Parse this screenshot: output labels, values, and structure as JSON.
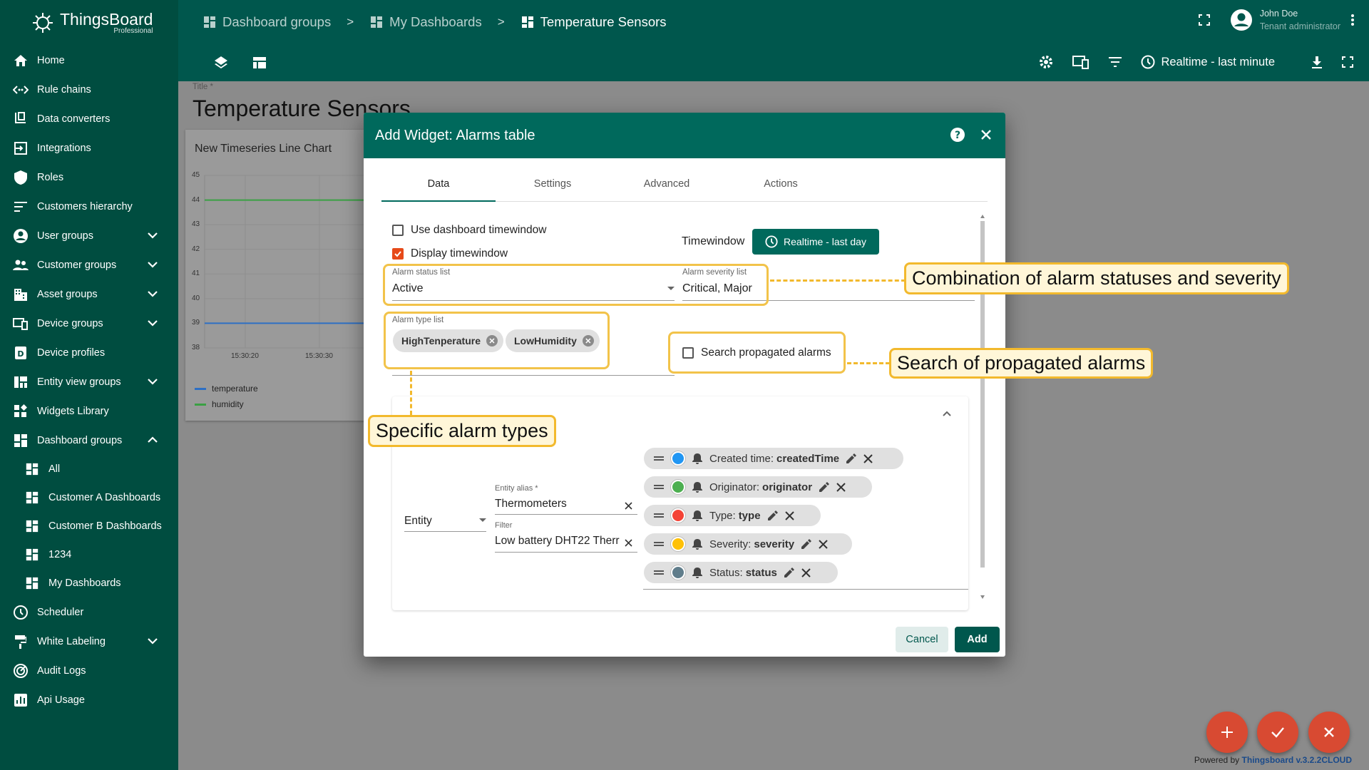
{
  "app": {
    "brand": "ThingsBoard",
    "edition": "Professional"
  },
  "sidebar": {
    "items": [
      {
        "label": "Home",
        "icon": "home-icon"
      },
      {
        "label": "Rule chains",
        "icon": "rule-chains-icon"
      },
      {
        "label": "Data converters",
        "icon": "converter-icon"
      },
      {
        "label": "Integrations",
        "icon": "integrations-icon"
      },
      {
        "label": "Roles",
        "icon": "shield-icon"
      },
      {
        "label": "Customers hierarchy",
        "icon": "hierarchy-icon"
      },
      {
        "label": "User groups",
        "icon": "account-circle-icon",
        "expandable": true
      },
      {
        "label": "Customer groups",
        "icon": "supervisor-icon",
        "expandable": true
      },
      {
        "label": "Asset groups",
        "icon": "domain-icon",
        "expandable": true
      },
      {
        "label": "Device groups",
        "icon": "devices-icon",
        "expandable": true
      },
      {
        "label": "Device profiles",
        "icon": "device-profile-icon"
      },
      {
        "label": "Entity view groups",
        "icon": "view-quilt-icon",
        "expandable": true
      },
      {
        "label": "Widgets Library",
        "icon": "widgets-icon"
      },
      {
        "label": "Dashboard groups",
        "icon": "dashboard-icon",
        "expanded": true
      },
      {
        "label": "All",
        "icon": "dashboard-icon",
        "sub": true
      },
      {
        "label": "Customer A Dashboards",
        "icon": "dashboard-icon",
        "sub": true
      },
      {
        "label": "Customer B Dashboards",
        "icon": "dashboard-icon",
        "sub": true
      },
      {
        "label": "1234",
        "icon": "dashboard-icon",
        "sub": true
      },
      {
        "label": "My Dashboards",
        "icon": "dashboard-icon",
        "sub": true
      },
      {
        "label": "Scheduler",
        "icon": "schedule-icon"
      },
      {
        "label": "White Labeling",
        "icon": "format-paint-icon",
        "expandable": true
      },
      {
        "label": "Audit Logs",
        "icon": "track-changes-icon"
      },
      {
        "label": "Api Usage",
        "icon": "insert-chart-icon"
      }
    ]
  },
  "header": {
    "breadcrumbs": [
      "Dashboard groups",
      "My Dashboards",
      "Temperature Sensors"
    ],
    "user_name": "John Doe",
    "user_role": "Tenant administrator",
    "timewindow": "Realtime - last minute"
  },
  "dashboard": {
    "title_label": "Title *",
    "title": "Temperature Sensors",
    "chart_title": "New Timeseries Line Chart"
  },
  "chart_data": {
    "type": "line",
    "title": "New Timeseries Line Chart",
    "x_ticks": [
      "15:30:20",
      "15:30:30"
    ],
    "y_ticks": [
      45,
      44,
      43,
      42,
      41,
      40,
      39,
      38
    ],
    "ylim": [
      38,
      45
    ],
    "series": [
      {
        "name": "temperature",
        "color": "#2d6fc4",
        "values": [
          39,
          39
        ]
      },
      {
        "name": "humidity",
        "color": "#3aa043",
        "values": [
          44,
          44
        ]
      }
    ]
  },
  "dialog": {
    "title": "Add Widget: Alarms table",
    "tabs": [
      "Data",
      "Settings",
      "Advanced",
      "Actions"
    ],
    "use_dashboard_timewindow": "Use dashboard timewindow",
    "display_timewindow": "Display timewindow",
    "timewindow_label": "Timewindow",
    "timewindow_value": "Realtime - last day",
    "alarm_status_label": "Alarm status list",
    "alarm_status_value": "Active",
    "alarm_severity_label": "Alarm severity list",
    "alarm_severity_value": "Critical, Major",
    "alarm_type_label": "Alarm type list",
    "alarm_types": [
      "HighTenperature",
      "LowHumidity"
    ],
    "search_propagated": "Search propagated alarms",
    "entity_type": "Entity",
    "entity_alias_label": "Entity alias *",
    "entity_alias_value": "Thermometers",
    "filter_label": "Filter",
    "filter_value": "Low battery DHT22 Therr",
    "data_keys": [
      {
        "label": "Created time:",
        "key": "createdTime",
        "color": "#2196f3"
      },
      {
        "label": "Originator:",
        "key": "originator",
        "color": "#4caf50"
      },
      {
        "label": "Type:",
        "key": "type",
        "color": "#f44336"
      },
      {
        "label": "Severity:",
        "key": "severity",
        "color": "#ffc107"
      },
      {
        "label": "Status:",
        "key": "status",
        "color": "#607d8b"
      }
    ],
    "cancel": "Cancel",
    "add": "Add"
  },
  "callouts": {
    "statuses": "Combination of alarm statuses and severity",
    "propagated": "Search of propagated alarms",
    "types": "Specific alarm types"
  },
  "footer": {
    "powered_by": "Powered by",
    "version": "Thingsboard v.3.2.2CLOUD"
  }
}
